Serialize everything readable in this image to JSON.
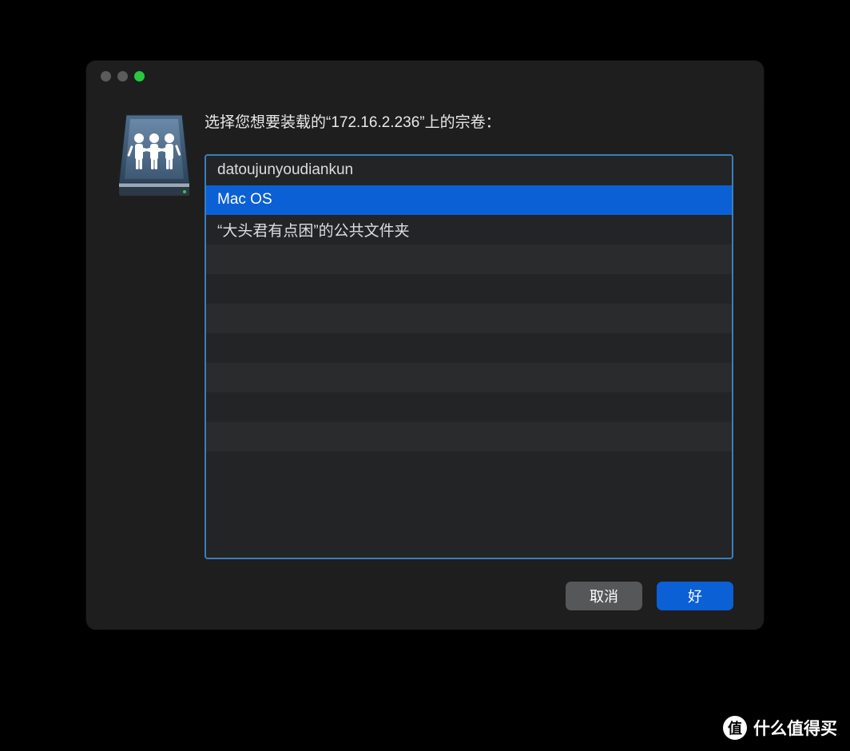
{
  "dialog": {
    "prompt": "选择您想要装载的“172.16.2.236”上的宗卷：",
    "volumes": [
      {
        "label": "datoujunyoudiankun",
        "selected": false
      },
      {
        "label": "Mac OS",
        "selected": true
      },
      {
        "label": "“大头君有点困”的公共文件夹",
        "selected": false
      }
    ],
    "buttons": {
      "cancel": "取消",
      "ok": "好"
    }
  },
  "watermark": {
    "badge": "值",
    "text": "什么值得买"
  },
  "colors": {
    "accent": "#0b60d6",
    "listbox_border": "#3b7fba",
    "window_bg": "#1e1e1e"
  },
  "list_total_rows": 11
}
